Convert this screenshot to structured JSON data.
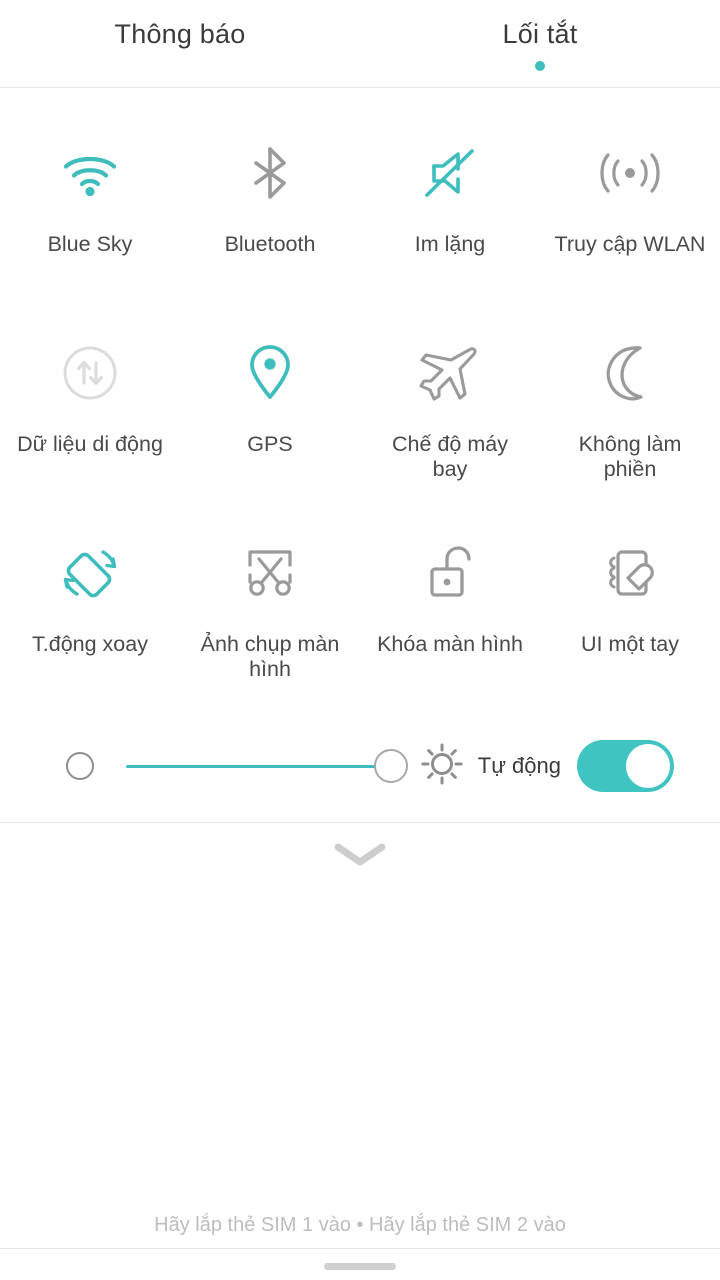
{
  "theme": {
    "accent": "#3fbdbd",
    "accent_switch": "#3fc4c2",
    "inactive_icon": "#9a9a9a",
    "disabled_icon": "#dcdcdc",
    "text": "#3b3b3b",
    "label": "#4a4a4a",
    "footer_text": "#bdbdbd",
    "background": "#ffffff",
    "divider": "#e8e8e8"
  },
  "header": {
    "tabs": [
      {
        "label": "Thông báo",
        "active": false,
        "name": "tab-notifications"
      },
      {
        "label": "Lối tắt",
        "active": true,
        "name": "tab-shortcuts"
      }
    ]
  },
  "tiles": [
    {
      "label": "Blue Sky",
      "icon": "wifi-icon",
      "state": "on"
    },
    {
      "label": "Bluetooth",
      "icon": "bluetooth-icon",
      "state": "off"
    },
    {
      "label": "Im lặng",
      "icon": "mute-icon",
      "state": "on"
    },
    {
      "label": "Truy cập WLAN",
      "icon": "hotspot-icon",
      "state": "off"
    },
    {
      "label": "Dữ liệu di động",
      "icon": "mobile-data-icon",
      "state": "disabled"
    },
    {
      "label": "GPS",
      "icon": "location-pin-icon",
      "state": "on"
    },
    {
      "label": "Chế độ máy bay",
      "icon": "airplane-icon",
      "state": "off"
    },
    {
      "label": "Không làm phiền",
      "icon": "moon-icon",
      "state": "off"
    },
    {
      "label": "T.động xoay",
      "icon": "auto-rotate-icon",
      "state": "on"
    },
    {
      "label": "Ảnh chụp màn hình",
      "icon": "screenshot-icon",
      "state": "off"
    },
    {
      "label": "Khóa màn hình",
      "icon": "padlock-open-icon",
      "state": "off"
    },
    {
      "label": "UI một tay",
      "icon": "one-handed-ui-icon",
      "state": "off"
    }
  ],
  "brightness": {
    "low_icon": "brightness-low-icon",
    "sun_icon": "brightness-sun-icon",
    "slider_value": 100,
    "auto_label": "Tự động",
    "auto_enabled": true
  },
  "collapse": {
    "icon": "chevron-down-icon"
  },
  "footer": {
    "text": "Hãy lắp thẻ SIM 1 vào • Hãy lắp thẻ SIM 2 vào"
  }
}
